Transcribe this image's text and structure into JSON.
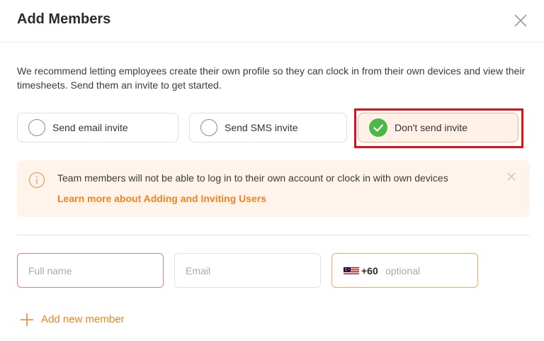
{
  "dialog": {
    "title": "Add Members",
    "description": "We recommend letting employees create their own profile so they can clock in from their own devices and view their timesheets. Send them an invite to get started."
  },
  "invite_options": [
    {
      "label": "Send email invite",
      "selected": false
    },
    {
      "label": "Send SMS invite",
      "selected": false
    },
    {
      "label": "Don't send invite",
      "selected": true
    }
  ],
  "alert": {
    "message": "Team members will not be able to log in to their own account or clock in with own devices",
    "link": "Learn more about Adding and Inviting Users"
  },
  "form": {
    "full_name_placeholder": "Full name",
    "email_placeholder": "Email",
    "phone_country_code": "+60",
    "phone_placeholder": "optional",
    "country_flag": "malaysia-flag-icon"
  },
  "add_member_label": "Add new member",
  "colors": {
    "accent": "#f58220",
    "selected_bg": "#fff1e8",
    "check_green": "#4cb848",
    "alert_bg": "#fff4ec",
    "error_border": "#f17a82",
    "highlight": "#e0101b"
  }
}
